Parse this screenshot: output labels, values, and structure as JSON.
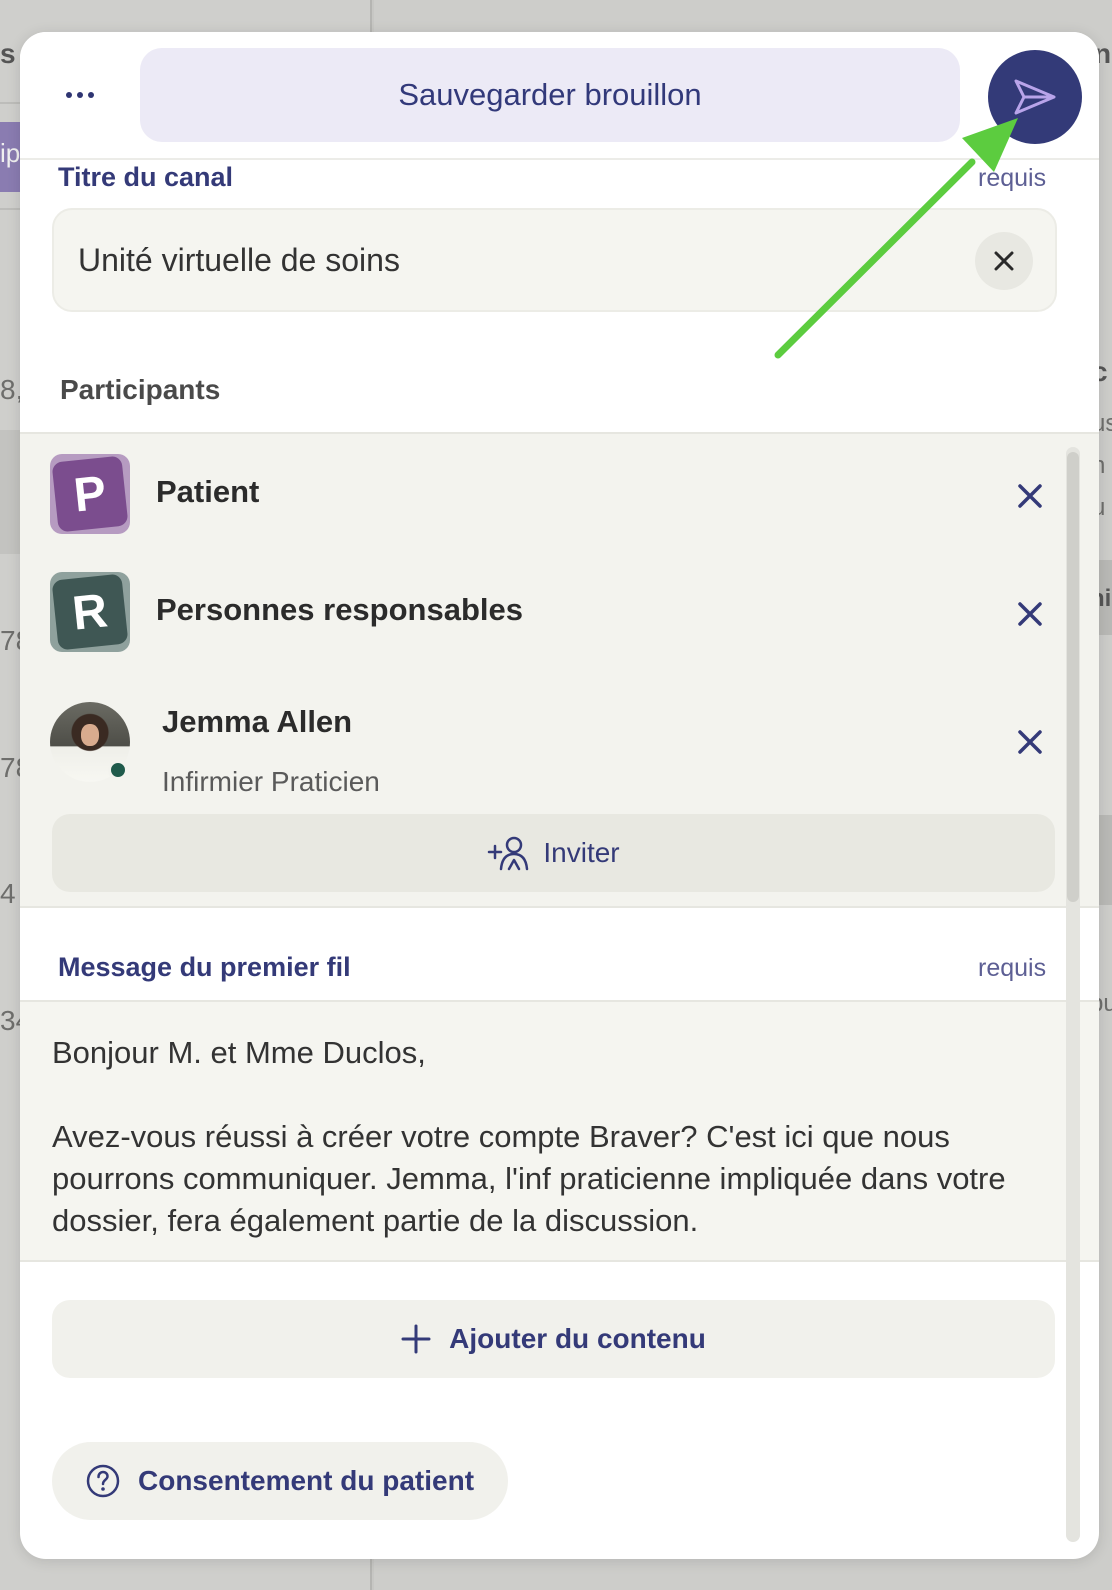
{
  "background": {
    "left_fragments": [
      "s",
      "ip",
      "8,",
      "78",
      "78",
      "4",
      "34"
    ],
    "right_fragments": [
      "n",
      "c",
      "us",
      "n",
      "u",
      "ni",
      "pu"
    ]
  },
  "topbar": {
    "more_label": "•••",
    "save_draft_label": "Sauvegarder brouillon"
  },
  "channel_title": {
    "label": "Titre du canal",
    "required": "requis",
    "value": "Unité virtuelle de soins"
  },
  "participants": {
    "label": "Participants",
    "items": [
      {
        "name": "Patient",
        "initial": "P",
        "tile_color": "#7b4d8e",
        "tile_bg": "#b69bc1"
      },
      {
        "name": "Personnes responsables",
        "initial": "R",
        "tile_color": "#3f5754",
        "tile_bg": "#8fa19d"
      },
      {
        "name": "Jemma Allen",
        "role": "Infirmier Praticien",
        "status": "online"
      }
    ],
    "invite_label": "Inviter"
  },
  "first_message": {
    "label": "Message du premier fil",
    "required": "requis",
    "text": "Bonjour M. et Mme Duclos,\n\nAvez-vous réussi à créer votre compte Braver? C'est ici que nous pourrons communiquer. Jemma, l'inf praticienne impliquée dans votre dossier, fera également partie de la discussion."
  },
  "actions": {
    "add_content_label": "Ajouter du contenu",
    "consent_label": "Consentement du patient"
  },
  "colors": {
    "accent": "#343a78",
    "annotation_arrow": "#5ccc3f"
  }
}
